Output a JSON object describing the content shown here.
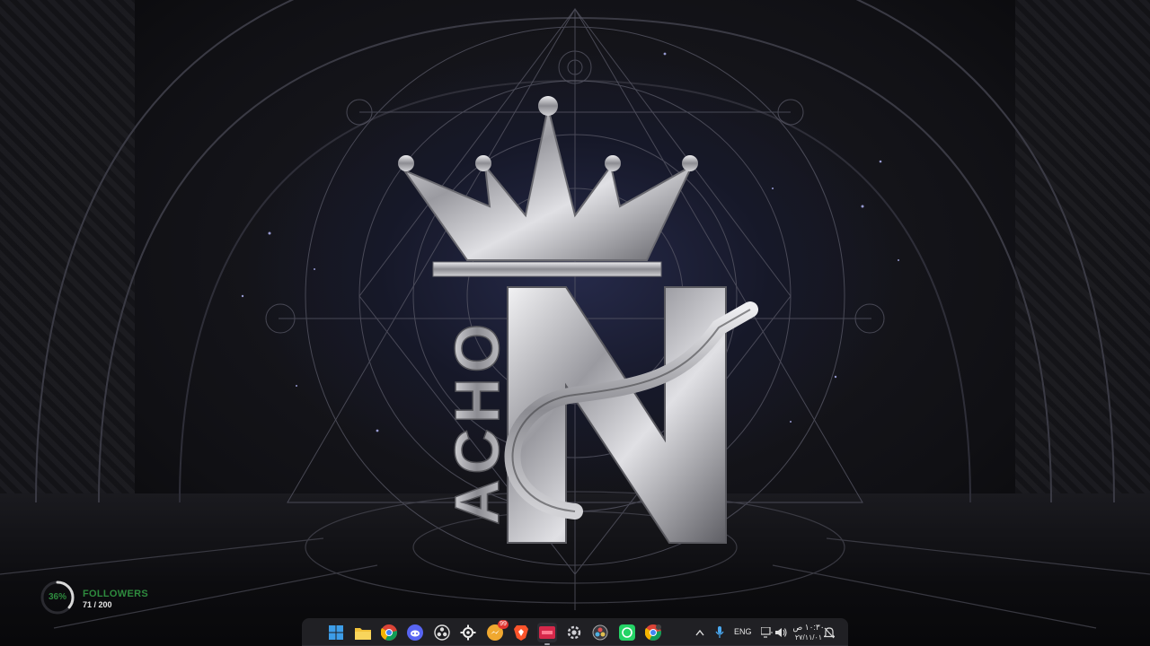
{
  "desktop": {
    "wallpaper": {
      "logo_text": "ACHO",
      "logo_letter": "N",
      "accent_color": "#3a3f8a",
      "metal_color": "#c8c8cc"
    }
  },
  "followers_widget": {
    "percent_label": "36%",
    "progress": 0.36,
    "label": "FOLLOWERS",
    "count": "71 / 200",
    "accent_color": "#2e8b3e"
  },
  "taskbar": {
    "apps": [
      {
        "name": "windows-start-icon"
      },
      {
        "name": "file-explorer-icon"
      },
      {
        "name": "chrome-icon"
      },
      {
        "name": "discord-icon"
      },
      {
        "name": "obs-icon"
      },
      {
        "name": "steelseries-icon"
      },
      {
        "name": "messenger-icon",
        "badge": "99"
      },
      {
        "name": "brave-icon"
      },
      {
        "name": "app-red-icon"
      },
      {
        "name": "settings-icon"
      },
      {
        "name": "davinci-icon"
      },
      {
        "name": "whatsapp-icon"
      },
      {
        "name": "chrome-profile-icon"
      }
    ],
    "tray": {
      "language": "ENG",
      "time": "١٠:٣٠ ص",
      "date": "٢٧/١١/٠١"
    }
  }
}
